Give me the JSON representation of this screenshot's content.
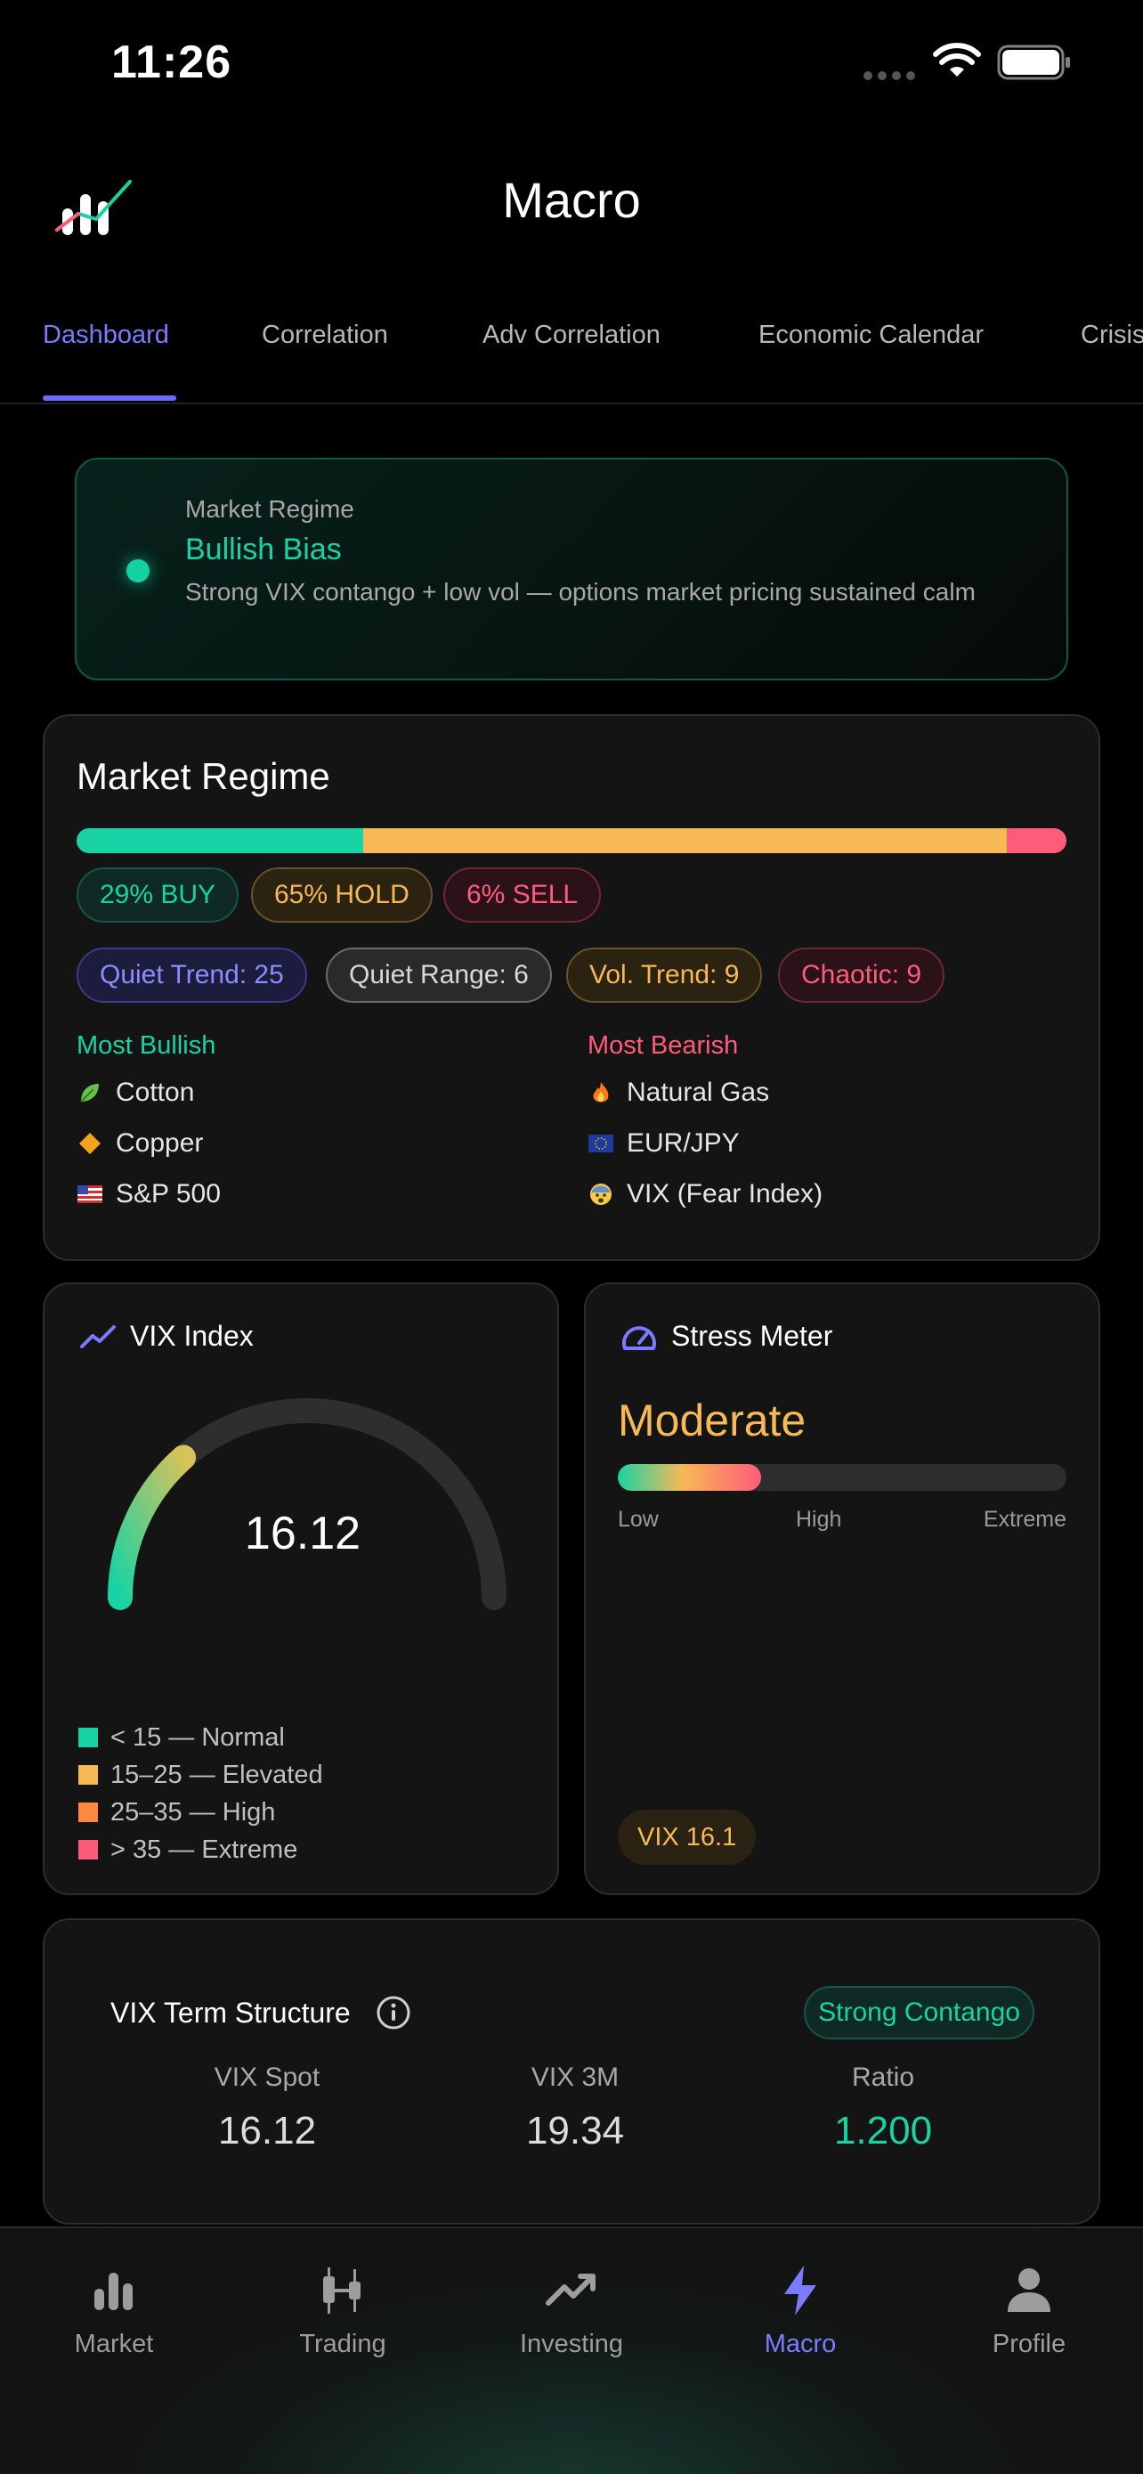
{
  "status_bar": {
    "time": "11:26"
  },
  "header": {
    "title": "Macro"
  },
  "tabs": [
    {
      "label": "Dashboard",
      "active": true
    },
    {
      "label": "Correlation",
      "active": false
    },
    {
      "label": "Adv Correlation",
      "active": false
    },
    {
      "label": "Economic Calendar",
      "active": false
    },
    {
      "label": "Crisis",
      "active": false
    }
  ],
  "banner": {
    "label": "Market Regime",
    "title": "Bullish Bias",
    "description": "Strong VIX contango + low vol — options market pricing sustained calm"
  },
  "regime": {
    "title": "Market Regime",
    "distribution": {
      "buy": 0.29,
      "hold": 0.65,
      "sell": 0.06
    },
    "signals": {
      "buy": "29% BUY",
      "hold": "65% HOLD",
      "sell": "6% SELL"
    },
    "states": {
      "quiet_trend": "Quiet Trend: 25",
      "quiet_range": "Quiet Range: 6",
      "vol_trend": "Vol. Trend: 9",
      "chaotic": "Chaotic: 9"
    },
    "most_bullish_label": "Most Bullish",
    "most_bearish_label": "Most Bearish",
    "most_bullish": [
      {
        "icon": "leaf-icon",
        "name": "Cotton"
      },
      {
        "icon": "diamond-icon",
        "name": "Copper"
      },
      {
        "icon": "us-flag-icon",
        "name": "S&P 500"
      }
    ],
    "most_bearish": [
      {
        "icon": "fire-icon",
        "name": "Natural Gas"
      },
      {
        "icon": "eu-flag-icon",
        "name": "EUR/JPY"
      },
      {
        "icon": "fearful-face-icon",
        "name": "VIX (Fear Index)"
      }
    ]
  },
  "vix_index": {
    "title": "VIX Index",
    "value": "16.12",
    "gauge_fraction": 0.27,
    "legend": [
      {
        "label": "< 15 — Normal",
        "color": "#18d3a3"
      },
      {
        "label": "15–25 — Elevated",
        "color": "#f7b955"
      },
      {
        "label": "25–35 — High",
        "color": "#ff8a3d"
      },
      {
        "label": "> 35 — Extreme",
        "color": "#ff5c7a"
      }
    ]
  },
  "stress_meter": {
    "title": "Stress Meter",
    "level": "Moderate",
    "fill_fraction": 0.32,
    "scale": {
      "low": "Low",
      "high": "High",
      "extreme": "Extreme"
    },
    "chip": "VIX 16.1"
  },
  "term_structure": {
    "title": "VIX Term Structure",
    "badge": "Strong Contango",
    "metrics": [
      {
        "label": "VIX Spot",
        "value": "16.12"
      },
      {
        "label": "VIX 3M",
        "value": "19.34"
      },
      {
        "label": "Ratio",
        "value": "1.200"
      }
    ]
  },
  "bottom_nav": [
    {
      "label": "Market",
      "icon": "bar-chart-icon",
      "active": false
    },
    {
      "label": "Trading",
      "icon": "candlestick-icon",
      "active": false
    },
    {
      "label": "Investing",
      "icon": "trend-up-icon",
      "active": false
    },
    {
      "label": "Macro",
      "icon": "lightning-icon",
      "active": true
    },
    {
      "label": "Profile",
      "icon": "person-icon",
      "active": false
    }
  ],
  "colors": {
    "accent": "#7b7bff",
    "bullish": "#18d3a3",
    "neutral": "#f7b955",
    "bearish": "#ff5c7a"
  }
}
